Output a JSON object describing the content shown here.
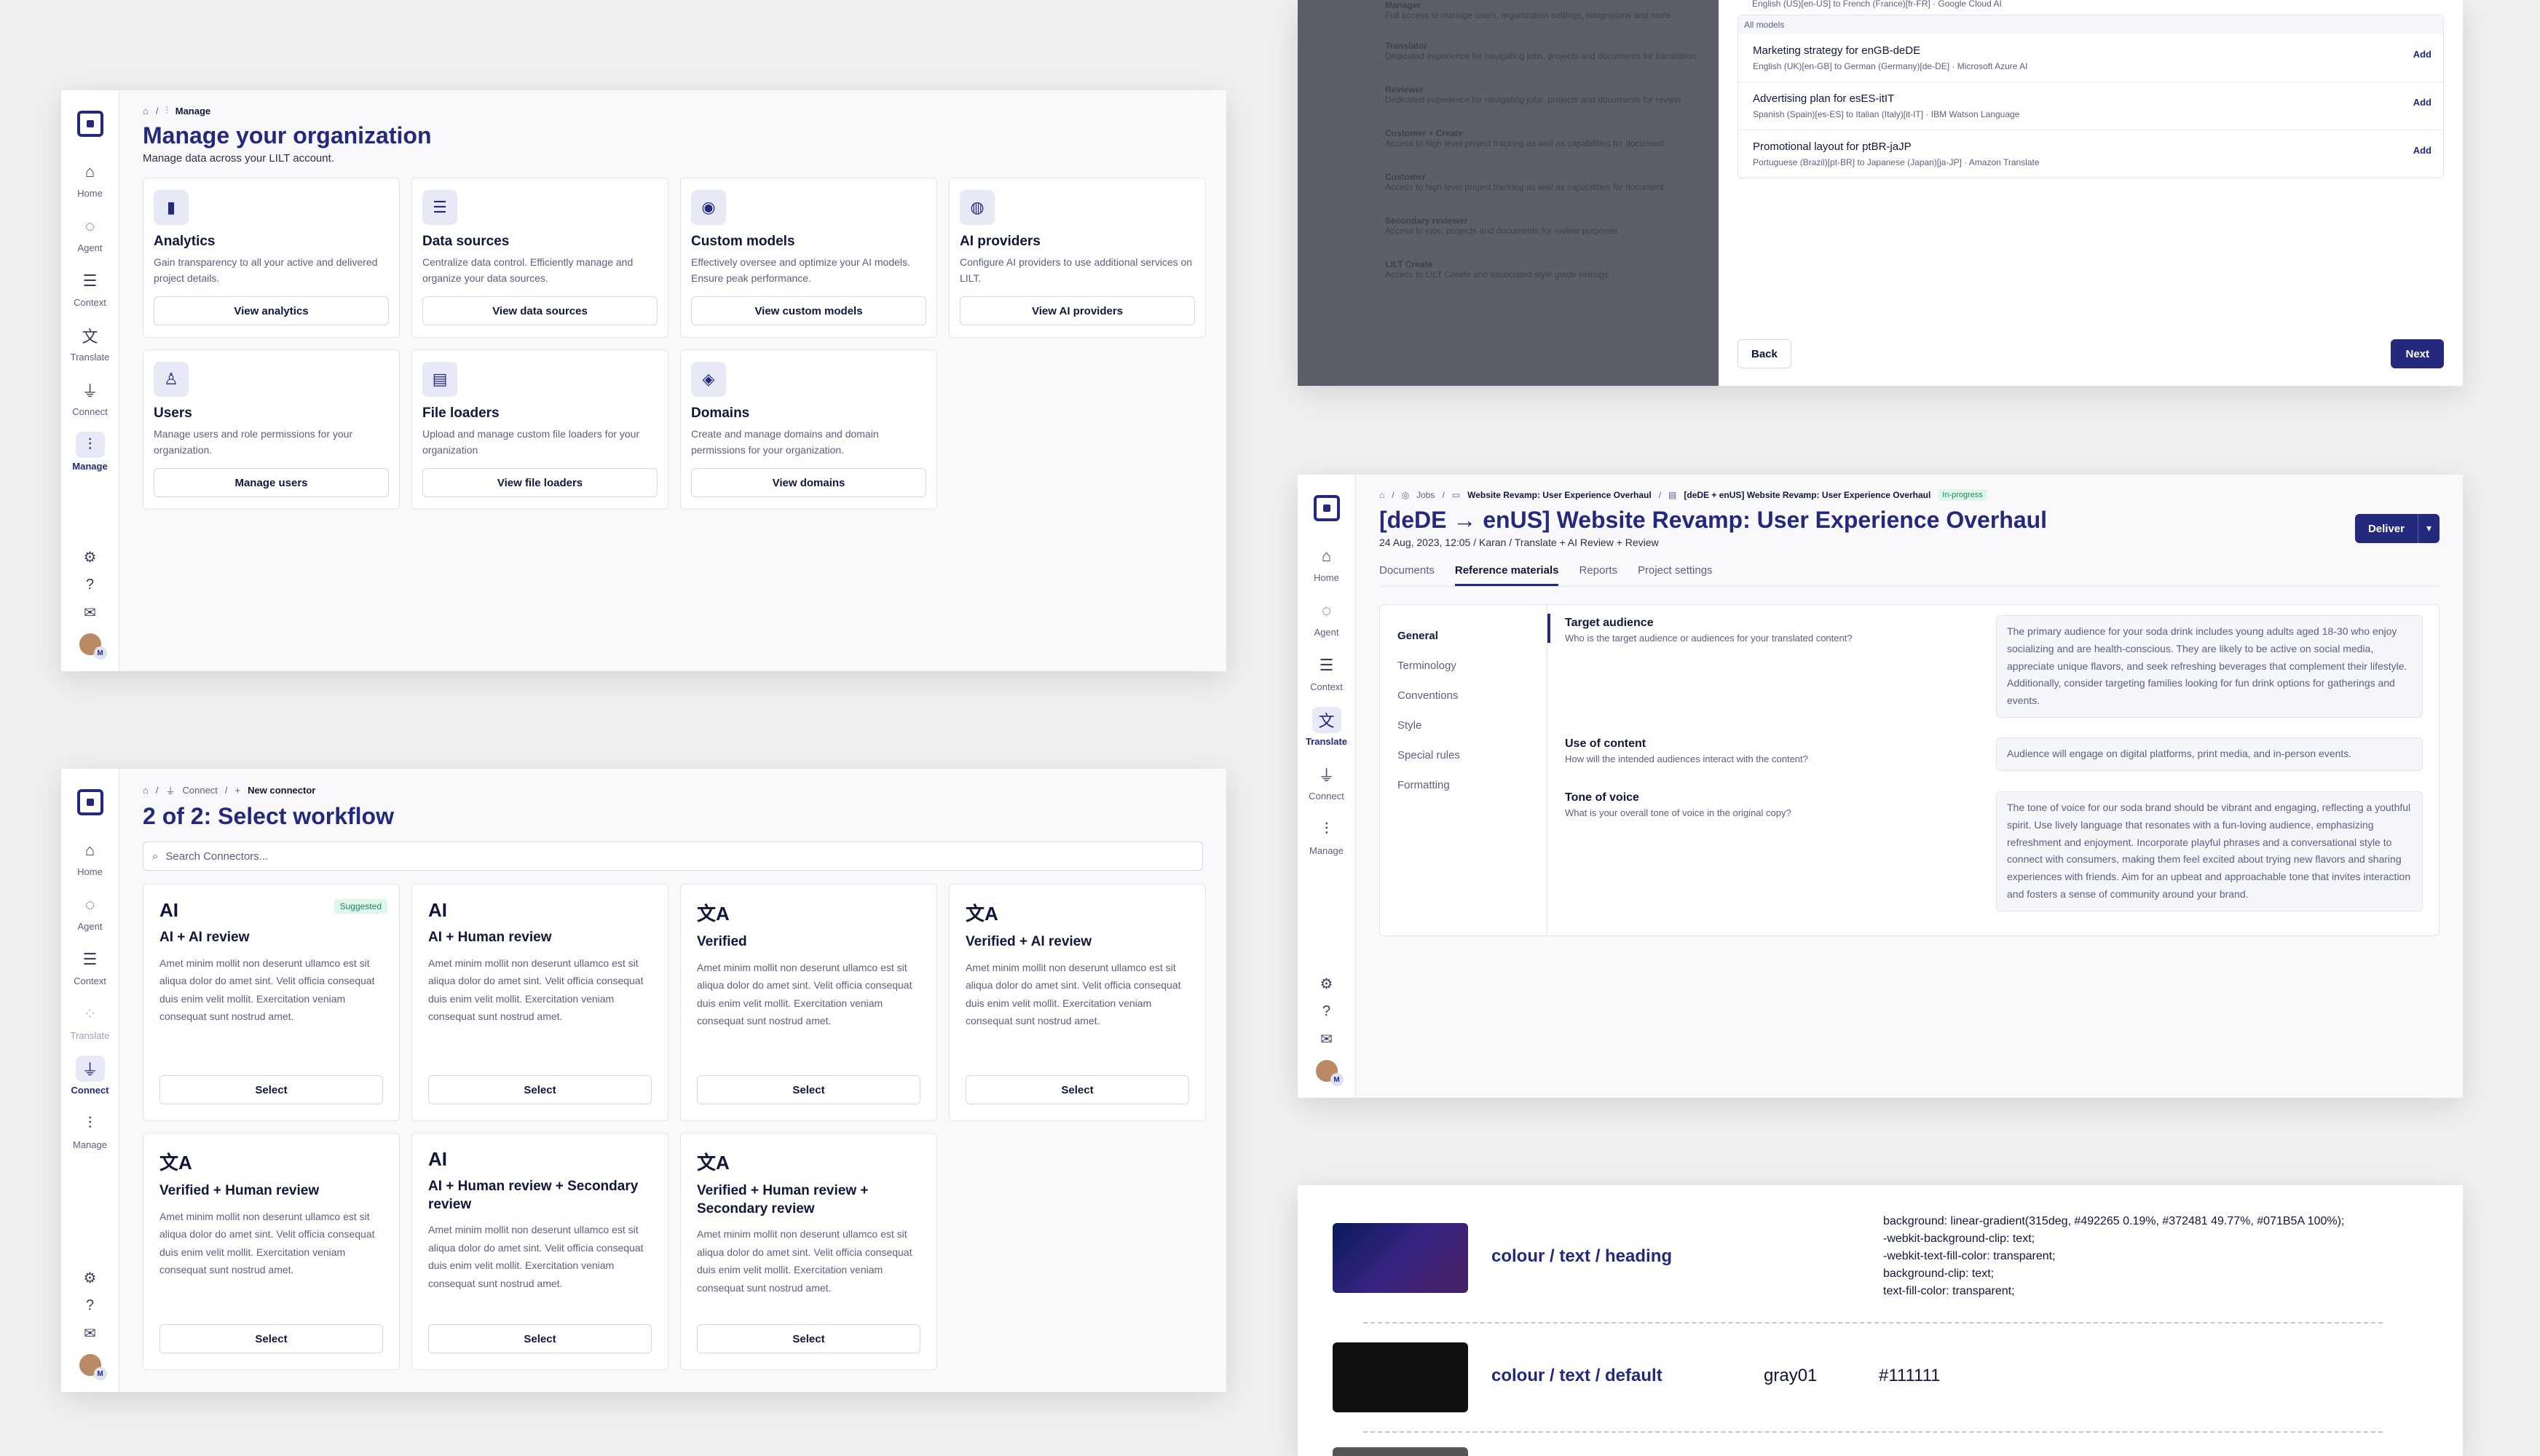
{
  "nav": {
    "home": "Home",
    "agent": "Agent",
    "context": "Context",
    "translate": "Translate",
    "connect": "Connect",
    "manage": "Manage"
  },
  "manage_panel": {
    "crumb": "Manage",
    "title": "Manage your organization",
    "subtitle": "Manage data across your LILT account.",
    "cards": [
      {
        "icon": "analytics-icon",
        "title": "Analytics",
        "desc": "Gain transparency to all your active and delivered project details.",
        "button": "View analytics"
      },
      {
        "icon": "database-icon",
        "title": "Data sources",
        "desc": "Centralize data control. Efficiently manage and organize your data sources.",
        "button": "View data sources"
      },
      {
        "icon": "brain-icon",
        "title": "Custom models",
        "desc": "Effectively oversee and optimize your AI models. Ensure peak performance.",
        "button": "View custom models"
      },
      {
        "icon": "ai-provider-icon",
        "title": "AI providers",
        "desc": "Configure AI providers to use additional services on LILT.",
        "button": "View AI providers"
      },
      {
        "icon": "user-icon",
        "title": "Users",
        "desc": "Manage users and role permissions for your organization.",
        "button": "Manage users"
      },
      {
        "icon": "file-icon",
        "title": "File loaders",
        "desc": "Upload and manage custom file loaders for your organization",
        "button": "View file loaders"
      },
      {
        "icon": "layers-icon",
        "title": "Domains",
        "desc": "Create and manage domains and domain permissions for your organization.",
        "button": "View domains"
      }
    ]
  },
  "workflow_panel": {
    "crumb1": "Connect",
    "crumb2": "New connector",
    "title": "2 of 2: Select workflow",
    "search_placeholder": "Search Connectors...",
    "suggested": "Suggested",
    "select_label": "Select",
    "lorem": "Amet minim mollit non deserunt ullamco est sit aliqua dolor do amet sint. Velit officia consequat duis enim velit mollit. Exercitation veniam consequat sunt nostrud amet.",
    "cards": [
      {
        "icon": "AI",
        "title": "AI + AI review"
      },
      {
        "icon": "AI",
        "title": "AI + Human review"
      },
      {
        "icon": "文A",
        "title": "Verified"
      },
      {
        "icon": "文A",
        "title": "Verified + AI review"
      },
      {
        "icon": "文A",
        "title": "Verified + Human review"
      },
      {
        "icon": "AI",
        "title": "AI + Human review + Secondary review"
      },
      {
        "icon": "文A",
        "title": "Verified + Human review + Secondary review"
      }
    ]
  },
  "dialog_panel": {
    "top_line": "English (US)[en-US] to French (France)[fr-FR]  ·  Google Cloud AI",
    "section": "All models",
    "add_label": "Add",
    "models": [
      {
        "name": "Marketing strategy for enGB-deDE",
        "detail": "English (UK)[en-GB] to German (Germany)[de-DE]  ·  Microsoft Azure AI"
      },
      {
        "name": "Advertising plan for esES-itIT",
        "detail": "Spanish (Spain)[es-ES] to Italian (Italy)[it-IT]  ·  IBM Watson Language"
      },
      {
        "name": "Promotional layout for ptBR-jaJP",
        "detail": "Portuguese (Brazil)[pt-BR] to Japanese (Japan)[ja-JP]  ·  Amazon Translate"
      }
    ],
    "back": "Back",
    "next": "Next",
    "overlay_rows": [
      {
        "t": "Manager",
        "d": "Full access to manage users, organization settings, integrations and more"
      },
      {
        "t": "Translator",
        "d": "Dedicated experience for navigating jobs, projects and documents for translation"
      },
      {
        "t": "Reviewer",
        "d": "Dedicated experience for navigating jobs, projects and documents for review"
      },
      {
        "t": "Customer + Create",
        "d": "Access to high level project tracking as well as capabilities for document"
      },
      {
        "t": "Customer",
        "d": "Access to high level project tracking as well as capabilities for document"
      },
      {
        "t": "Secondary reviewer",
        "d": "Access to jobs, projects and documents for review purposes"
      },
      {
        "t": "LILT Create",
        "d": "Access to LILT Create and associated style guide settings"
      }
    ]
  },
  "project_panel": {
    "crumb_jobs": "Jobs",
    "crumb_job": "Website Revamp: User Experience Overhaul",
    "crumb_doc": "[deDE + enUS] Website Revamp: User Experience Overhaul",
    "status": "In-progress",
    "title": "[deDE → enUS] Website Revamp: User Experience Overhaul",
    "meta": "24 Aug, 2023, 12:05 /  Karan / Translate + AI Review + Review",
    "deliver": "Deliver",
    "tabs": [
      "Documents",
      "Reference materials",
      "Reports",
      "Project settings"
    ],
    "side": [
      "General",
      "Terminology",
      "Conventions",
      "Style",
      "Special rules",
      "Formatting"
    ],
    "questions": [
      {
        "title": "Target audience",
        "sub": "Who is the target audience or audiences for your translated content?",
        "answer": "The primary audience for your soda drink includes young adults aged 18-30 who enjoy socializing and are health-conscious. They are likely to be active on social media, appreciate unique flavors, and seek refreshing beverages that complement their lifestyle. Additionally, consider targeting families looking for fun drink options for gatherings and events."
      },
      {
        "title": "Use of content",
        "sub": "How will the intended audiences interact with the content?",
        "answer": "Audience will engage on digital platforms, print media, and in-person events."
      },
      {
        "title": "Tone of voice",
        "sub": "What is your overall tone of voice in the original copy?",
        "answer": "The tone of voice for our soda brand should be vibrant and engaging, reflecting a youthful spirit. Use lively language that resonates with a fun-loving audience, emphasizing refreshment and enjoyment. Incorporate playful phrases and a conversational style to connect with consumers, making them feel excited about trying new flavors and sharing experiences with friends. Aim for an upbeat and approachable tone that invites interaction and fosters a sense of community around your brand."
      }
    ]
  },
  "colors_panel": {
    "rows": [
      {
        "label": "colour / text / heading",
        "code": "background: linear-gradient(315deg, #492265 0.19%, #372481 49.77%, #071B5A 100%);\n-webkit-background-clip: text;\n-webkit-text-fill-color: transparent;\nbackground-clip: text;\ntext-fill-color: transparent;"
      },
      {
        "label": "colour / text / default",
        "token": "gray01",
        "hex": "#111111"
      }
    ]
  }
}
